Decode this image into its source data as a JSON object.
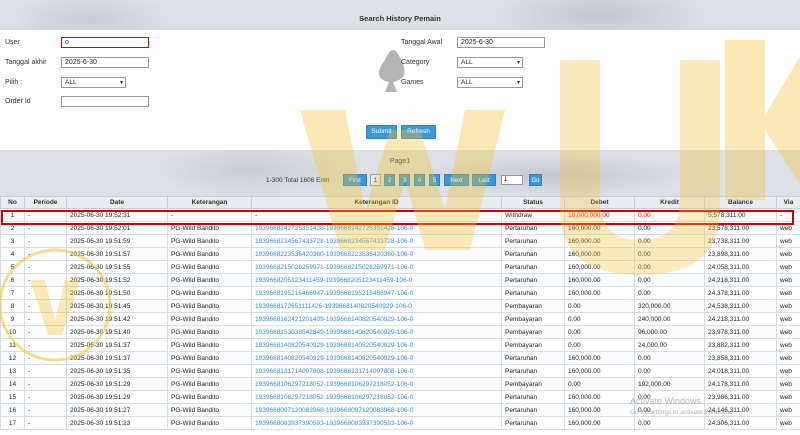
{
  "title": "Search History Pemain",
  "form": {
    "user_label": "User",
    "user_value": "o",
    "tanggal_akhir_label": "Tanggal akhir",
    "tanggal_akhir_value": "2025-6-30",
    "pilih_label": "Pilih :",
    "pilih_value": "ALL",
    "order_id_label": "Order Id",
    "order_id_value": "",
    "tanggal_awal_label": "Tanggal Awal",
    "tanggal_awal_value": "2025-6-30",
    "category_label": "Category",
    "category_value": "ALL",
    "games_label": "Games",
    "games_value": "ALL",
    "submit_label": "Submit",
    "refresh_label": "Refresh"
  },
  "pager": {
    "page_title": "Page1",
    "total_text": "1-300 Total 1606 Entri",
    "first": "First",
    "pages": [
      "1",
      "2",
      "3",
      "4",
      "5"
    ],
    "next": "Next",
    "last": "Last",
    "goto_value": "1",
    "go": "Go"
  },
  "table": {
    "headers": [
      "No",
      "Periode",
      "Date",
      "Keterangan",
      "Keterangan ID",
      "Status",
      "Debet",
      "Kredit",
      "Balance",
      "Via"
    ],
    "rows": [
      [
        "1",
        "-",
        "2025-06-30 19:52:31",
        "-",
        "-",
        "Withdraw",
        "18,000,000.00",
        "0.00",
        "5,578,311.00",
        "-"
      ],
      [
        "2",
        "-",
        "2025-06-30 19:52:01",
        "PG-Wild Bandito",
        "1939668242725351428-1939668242725351428-106-0",
        "Pertaruhan",
        "160,000.00",
        "0.00",
        "23,578,311.00",
        "web"
      ],
      [
        "3",
        "-",
        "2025-06-30 19:51:59",
        "PG-Wild Bandito",
        "1939668234567433728-1939668234567433728-106-0",
        "Pertaruhan",
        "160,000.00",
        "0.00",
        "23,738,311.00",
        "web"
      ],
      [
        "4",
        "-",
        "2025-06-30 19:51:57",
        "PG-Wild Bandito",
        "1939668223536420360-1939668223536420360-106-0",
        "Pertaruhan",
        "160,000.00",
        "0.00",
        "23,898,311.00",
        "web"
      ],
      [
        "5",
        "-",
        "2025-06-30 19:51:55",
        "PG-Wild Bandito",
        "1939668215026259971-1939668215026259971-106-0",
        "Pertaruhan",
        "160,000.00",
        "0.00",
        "24,058,311.00",
        "web"
      ],
      [
        "6",
        "-",
        "2025-06-30 19:51:52",
        "PG-Wild Bandito",
        "1939668205123411459-1939668205123411459-106-0",
        "Pertaruhan",
        "160,000.00",
        "0.00",
        "24,218,311.00",
        "web"
      ],
      [
        "7",
        "-",
        "2025-06-30 19:51:50",
        "PG-Wild Bandito",
        "1939668195216466947-1939668195216466947-106-0",
        "Pertaruhan",
        "160,000.00",
        "0.00",
        "24,378,311.00",
        "web"
      ],
      [
        "8",
        "-",
        "2025-06-30 19:51:45",
        "PG-Wild Bandito",
        "1939668172651111426-1939668140820540929-106-0",
        "Pembayaran",
        "0.00",
        "320,000.00",
        "24,538,311.00",
        "web"
      ],
      [
        "9",
        "-",
        "2025-06-30 19:51:42",
        "PG-Wild Bandito",
        "1939668162421201409-1939668140820540929-106-0",
        "Pembayaran",
        "0.00",
        "240,000.00",
        "24,218,311.00",
        "web"
      ],
      [
        "10",
        "-",
        "2025-06-30 19:51:40",
        "PG-Wild Bandito",
        "1939668153038542849-1939668140820540929-106-0",
        "Pembayaran",
        "0.00",
        "96,000.00",
        "23,978,311.00",
        "web"
      ],
      [
        "11",
        "-",
        "2025-06-30 19:51:37",
        "PG-Wild Bandito",
        "1939668140820540929-1939668140820540929-106-0",
        "Pembayaran",
        "0.00",
        "24,000.00",
        "23,882,311.00",
        "web"
      ],
      [
        "12",
        "-",
        "2025-06-30 19:51:37",
        "PG-Wild Bandito",
        "1939668140820540929-1939668140820540929-106-0",
        "Pertaruhan",
        "160,000.00",
        "0.00",
        "23,858,311.00",
        "web"
      ],
      [
        "13",
        "-",
        "2025-06-30 19:51:35",
        "PG-Wild Bandito",
        "1939668131714007808-1939668131714007808-106-0",
        "Pertaruhan",
        "160,000.00",
        "0.00",
        "24,018,311.00",
        "web"
      ],
      [
        "14",
        "-",
        "2025-06-30 19:51:29",
        "PG-Wild Bandito",
        "1939668106297218052-1939668106297218052-106-0",
        "Pembayaran",
        "0.00",
        "192,000.00",
        "24,178,311.00",
        "web"
      ],
      [
        "15",
        "-",
        "2025-06-30 19:51:29",
        "PG-Wild Bandito",
        "1939668106297218052-1939668106297218052-106-0",
        "Pertaruhan",
        "160,000.00",
        "0.00",
        "23,986,311.00",
        "web"
      ],
      [
        "16",
        "-",
        "2025-06-30 19:51:27",
        "PG-Wild Bandito",
        "1939668097120083968-1939668097120083968-106-0",
        "Pertaruhan",
        "160,000.00",
        "0.00",
        "24,146,311.00",
        "web"
      ],
      [
        "17",
        "-",
        "2025-06-30 19:51:23",
        "PG-Wild Bandito",
        "1939668083937390593-1939668083937390593-106-0",
        "Pertaruhan",
        "160,000.00",
        "0.00",
        "24,306,311.00",
        "web"
      ]
    ]
  },
  "watermark": {
    "line1": "Activate Windows",
    "line2": "Go to Settings to activate Windows."
  },
  "colors": {
    "accent": "#3a9ad9",
    "highlight": "#cc0000",
    "link": "#3a8ed0",
    "logo_gold": "#f2c230"
  },
  "overlay_logo_text": "WOW UK"
}
